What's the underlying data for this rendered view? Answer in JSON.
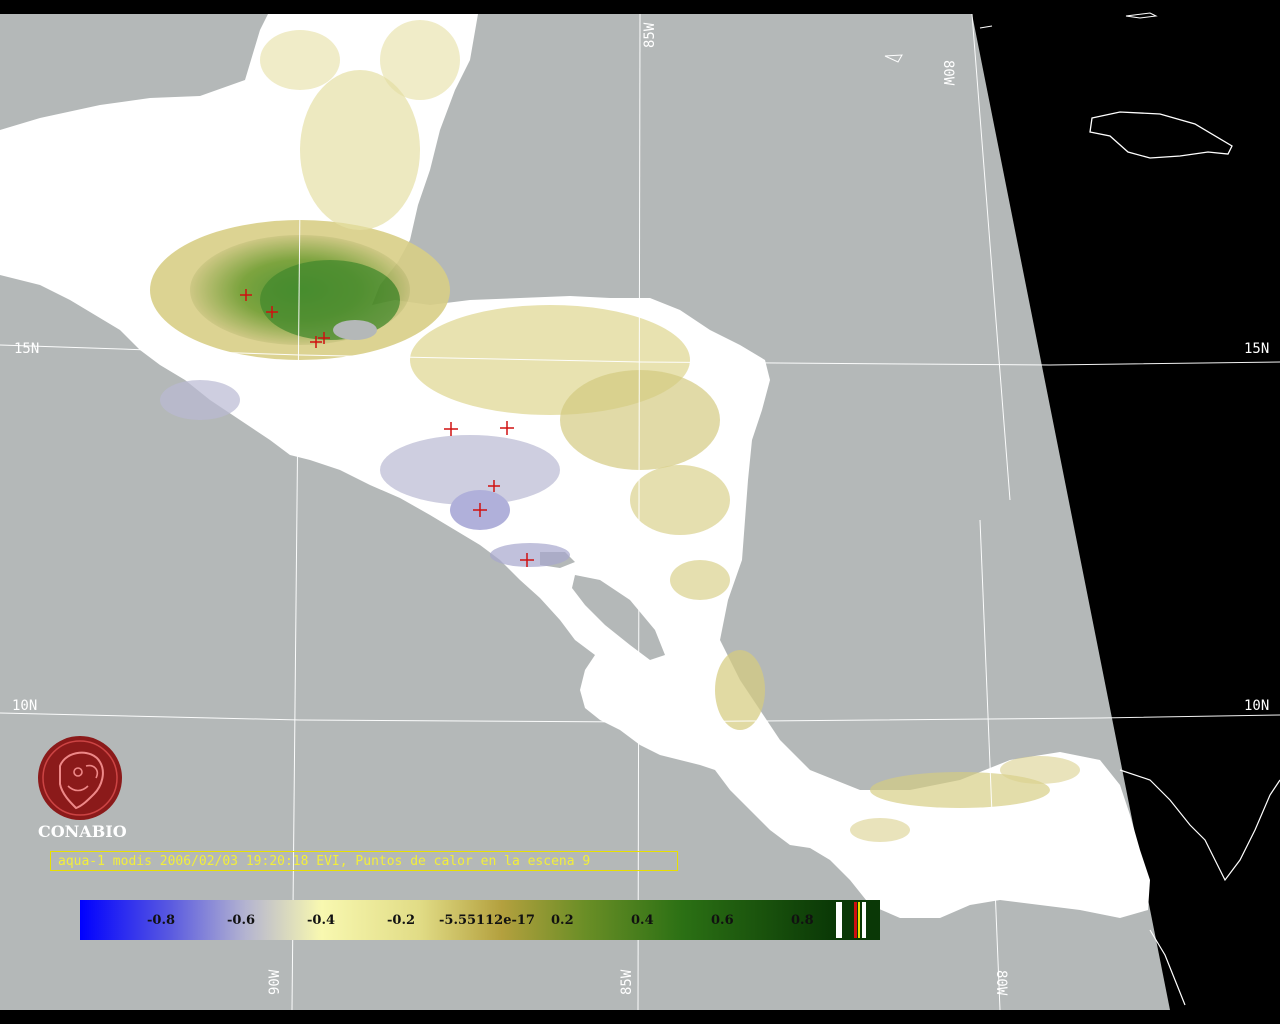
{
  "caption": "aqua-1 modis 2006/02/03 19:20:18 EVI, Puntos de calor en la escena 9",
  "logo": {
    "text": "CONABIO",
    "icon": "conabio-macaw-logo-icon"
  },
  "grid_labels": {
    "lat_15n_left": "15N",
    "lat_15n_right": "15N",
    "lat_10n_left": "10N",
    "lat_10n_right": "10N",
    "lon_85w_top": "85W",
    "lon_80w_top": "80W",
    "lon_90w_bottom": "90W",
    "lon_85w_bottom": "85W",
    "lon_80w_bottom": "80W"
  },
  "colorbar": {
    "ticks": [
      {
        "label": "-0.8"
      },
      {
        "label": "-0.6"
      },
      {
        "label": "-0.4"
      },
      {
        "label": "-0.2"
      },
      {
        "label": "-5.55112e-17"
      },
      {
        "label": "0.2"
      },
      {
        "label": "0.4"
      },
      {
        "label": "0.6"
      },
      {
        "label": "0.8"
      }
    ],
    "colors": [
      "#0000ff",
      "#6b6bdc",
      "#b9b9cf",
      "#f6f6b2",
      "#dcd77c",
      "#b5a040",
      "#4f8a1c",
      "#1e6b10",
      "#0b3f07"
    ]
  },
  "colors": {
    "ocean": "#b4b8b8",
    "outside_swath": "#000000",
    "land_no_data": "#ffffff",
    "hotspot": "#d01010",
    "grid": "#ffffff"
  },
  "hotspots_count": 9
}
